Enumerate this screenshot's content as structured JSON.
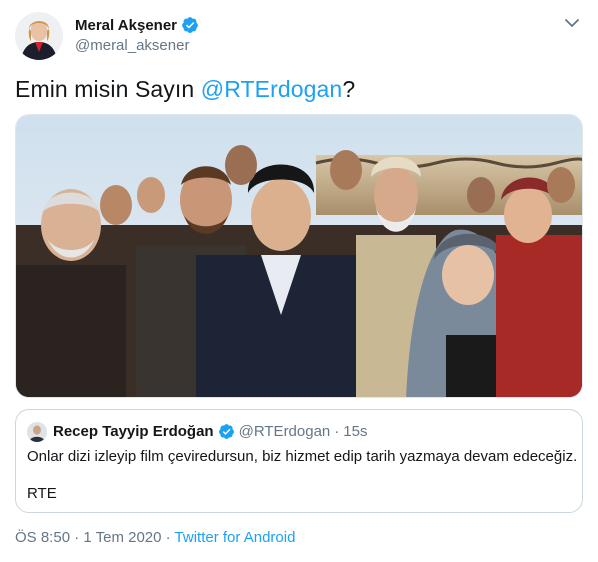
{
  "author": {
    "display_name": "Meral Akşener",
    "handle": "@meral_aksener",
    "verified_icon": "verified-badge-icon"
  },
  "tweet": {
    "text_prefix": "Emin misin Sayın ",
    "mention": "@RTErdogan",
    "text_suffix": "?"
  },
  "quoted_tweet": {
    "display_name": "Recep Tayyip Erdoğan",
    "handle": "@RTErdogan",
    "separator": "·",
    "time": "15s",
    "body": "Onlar dizi izleyip film çeviredursun, biz hizmet edip tarih yazmaya devam edeceğiz.",
    "signature": "RTE"
  },
  "meta": {
    "timestamp": "ÖS 8:50 · 1 Tem 2020 · ",
    "source": "Twitter for Android"
  },
  "colors": {
    "link": "#1da1f2",
    "secondary_text": "#657786",
    "border": "#ccd6dd"
  }
}
